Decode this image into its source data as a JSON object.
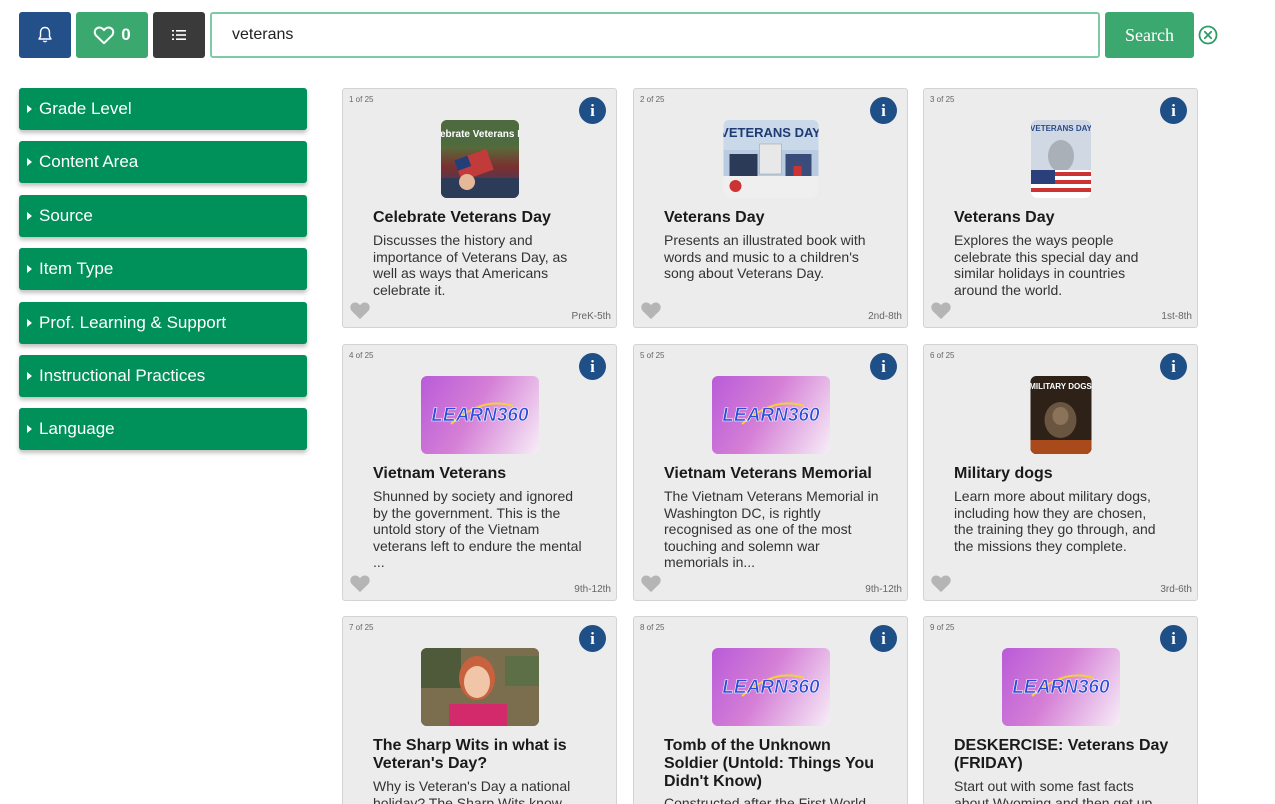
{
  "toolbar": {
    "favorites_count": "0",
    "search_value": "veterans",
    "search_label": "Search"
  },
  "facets": [
    "Grade Level",
    "Content Area",
    "Source",
    "Item Type",
    "Prof. Learning & Support",
    "Instructional Practices",
    "Language"
  ],
  "cards": [
    {
      "count": "1 of 25",
      "title": "Celebrate Veterans Day",
      "desc": "Discusses the history and importance of Veterans Day, as well as ways that Americans celebrate it.",
      "grade": "PreK-5th",
      "thumb_text": "Celebrate Veterans Day"
    },
    {
      "count": "2 of 25",
      "title": "Veterans Day",
      "desc": "Presents an illustrated book with words and music to a children's song about Veterans Day.",
      "grade": "2nd-8th",
      "thumb_text": "VETERANS DAY"
    },
    {
      "count": "3 of 25",
      "title": "Veterans Day",
      "desc": "Explores the ways people celebrate this special day and similar holidays in countries around the world.",
      "grade": "1st-8th",
      "thumb_text": "VETERANS DAY"
    },
    {
      "count": "4 of 25",
      "title": "Vietnam Veterans",
      "desc": "Shunned by society and ignored by the government. This is the untold story of the Vietnam veterans left to endure the mental ...",
      "grade": "9th-12th",
      "thumb_text": "LEARN360"
    },
    {
      "count": "5 of 25",
      "title": "Vietnam Veterans Memorial",
      "desc": "The Vietnam Veterans Memorial in Washington DC, is rightly recognised as one of the most touching and solemn war memorials in...",
      "grade": "9th-12th",
      "thumb_text": "LEARN360"
    },
    {
      "count": "6 of 25",
      "title": "Military dogs",
      "desc": "Learn more about military dogs, including how they are chosen, the training they go through, and the missions they complete.",
      "grade": "3rd-6th",
      "thumb_text": "MILITARY DOGS"
    },
    {
      "count": "7 of 25",
      "title": "The Sharp Wits in what is Veteran's Day?",
      "desc": "Why is Veteran's Day a national holiday? The Sharp Wits know...",
      "grade": "",
      "thumb_text": ""
    },
    {
      "count": "8 of 25",
      "title": "Tomb of the Unknown Soldier (Untold: Things You Didn't Know)",
      "desc": "Constructed after the First World...",
      "grade": "",
      "thumb_text": "LEARN360"
    },
    {
      "count": "9 of 25",
      "title": "DESKERCISE: Veterans Day (FRIDAY)",
      "desc": "Start out with some fast facts about Wyoming and then get up...",
      "grade": "",
      "thumb_text": "LEARN360"
    }
  ],
  "colors": {
    "accent_green": "#00915a",
    "button_green": "#3ba96f",
    "navy": "#1e4f86"
  }
}
